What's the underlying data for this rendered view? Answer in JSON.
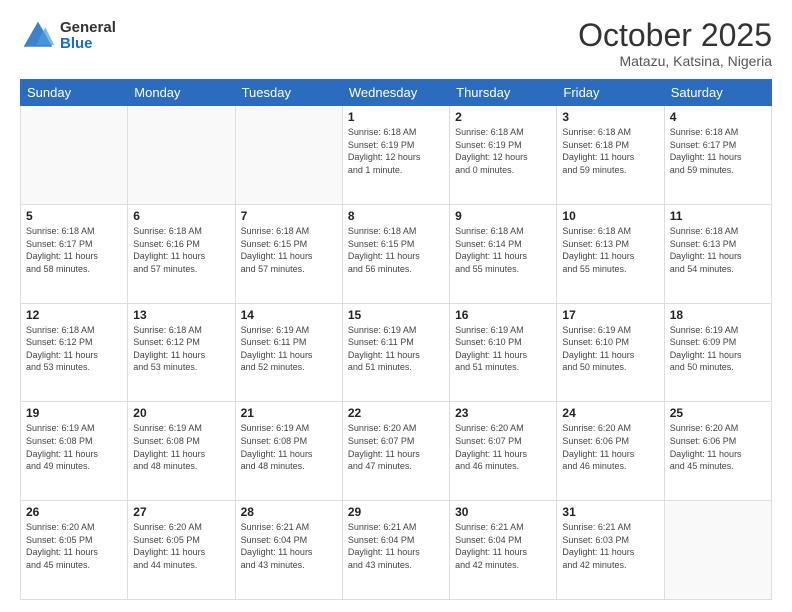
{
  "logo": {
    "general": "General",
    "blue": "Blue"
  },
  "header": {
    "month": "October 2025",
    "location": "Matazu, Katsina, Nigeria"
  },
  "weekdays": [
    "Sunday",
    "Monday",
    "Tuesday",
    "Wednesday",
    "Thursday",
    "Friday",
    "Saturday"
  ],
  "weeks": [
    [
      {
        "day": "",
        "info": ""
      },
      {
        "day": "",
        "info": ""
      },
      {
        "day": "",
        "info": ""
      },
      {
        "day": "1",
        "info": "Sunrise: 6:18 AM\nSunset: 6:19 PM\nDaylight: 12 hours\nand 1 minute."
      },
      {
        "day": "2",
        "info": "Sunrise: 6:18 AM\nSunset: 6:19 PM\nDaylight: 12 hours\nand 0 minutes."
      },
      {
        "day": "3",
        "info": "Sunrise: 6:18 AM\nSunset: 6:18 PM\nDaylight: 11 hours\nand 59 minutes."
      },
      {
        "day": "4",
        "info": "Sunrise: 6:18 AM\nSunset: 6:17 PM\nDaylight: 11 hours\nand 59 minutes."
      }
    ],
    [
      {
        "day": "5",
        "info": "Sunrise: 6:18 AM\nSunset: 6:17 PM\nDaylight: 11 hours\nand 58 minutes."
      },
      {
        "day": "6",
        "info": "Sunrise: 6:18 AM\nSunset: 6:16 PM\nDaylight: 11 hours\nand 57 minutes."
      },
      {
        "day": "7",
        "info": "Sunrise: 6:18 AM\nSunset: 6:15 PM\nDaylight: 11 hours\nand 57 minutes."
      },
      {
        "day": "8",
        "info": "Sunrise: 6:18 AM\nSunset: 6:15 PM\nDaylight: 11 hours\nand 56 minutes."
      },
      {
        "day": "9",
        "info": "Sunrise: 6:18 AM\nSunset: 6:14 PM\nDaylight: 11 hours\nand 55 minutes."
      },
      {
        "day": "10",
        "info": "Sunrise: 6:18 AM\nSunset: 6:13 PM\nDaylight: 11 hours\nand 55 minutes."
      },
      {
        "day": "11",
        "info": "Sunrise: 6:18 AM\nSunset: 6:13 PM\nDaylight: 11 hours\nand 54 minutes."
      }
    ],
    [
      {
        "day": "12",
        "info": "Sunrise: 6:18 AM\nSunset: 6:12 PM\nDaylight: 11 hours\nand 53 minutes."
      },
      {
        "day": "13",
        "info": "Sunrise: 6:18 AM\nSunset: 6:12 PM\nDaylight: 11 hours\nand 53 minutes."
      },
      {
        "day": "14",
        "info": "Sunrise: 6:19 AM\nSunset: 6:11 PM\nDaylight: 11 hours\nand 52 minutes."
      },
      {
        "day": "15",
        "info": "Sunrise: 6:19 AM\nSunset: 6:11 PM\nDaylight: 11 hours\nand 51 minutes."
      },
      {
        "day": "16",
        "info": "Sunrise: 6:19 AM\nSunset: 6:10 PM\nDaylight: 11 hours\nand 51 minutes."
      },
      {
        "day": "17",
        "info": "Sunrise: 6:19 AM\nSunset: 6:10 PM\nDaylight: 11 hours\nand 50 minutes."
      },
      {
        "day": "18",
        "info": "Sunrise: 6:19 AM\nSunset: 6:09 PM\nDaylight: 11 hours\nand 50 minutes."
      }
    ],
    [
      {
        "day": "19",
        "info": "Sunrise: 6:19 AM\nSunset: 6:08 PM\nDaylight: 11 hours\nand 49 minutes."
      },
      {
        "day": "20",
        "info": "Sunrise: 6:19 AM\nSunset: 6:08 PM\nDaylight: 11 hours\nand 48 minutes."
      },
      {
        "day": "21",
        "info": "Sunrise: 6:19 AM\nSunset: 6:08 PM\nDaylight: 11 hours\nand 48 minutes."
      },
      {
        "day": "22",
        "info": "Sunrise: 6:20 AM\nSunset: 6:07 PM\nDaylight: 11 hours\nand 47 minutes."
      },
      {
        "day": "23",
        "info": "Sunrise: 6:20 AM\nSunset: 6:07 PM\nDaylight: 11 hours\nand 46 minutes."
      },
      {
        "day": "24",
        "info": "Sunrise: 6:20 AM\nSunset: 6:06 PM\nDaylight: 11 hours\nand 46 minutes."
      },
      {
        "day": "25",
        "info": "Sunrise: 6:20 AM\nSunset: 6:06 PM\nDaylight: 11 hours\nand 45 minutes."
      }
    ],
    [
      {
        "day": "26",
        "info": "Sunrise: 6:20 AM\nSunset: 6:05 PM\nDaylight: 11 hours\nand 45 minutes."
      },
      {
        "day": "27",
        "info": "Sunrise: 6:20 AM\nSunset: 6:05 PM\nDaylight: 11 hours\nand 44 minutes."
      },
      {
        "day": "28",
        "info": "Sunrise: 6:21 AM\nSunset: 6:04 PM\nDaylight: 11 hours\nand 43 minutes."
      },
      {
        "day": "29",
        "info": "Sunrise: 6:21 AM\nSunset: 6:04 PM\nDaylight: 11 hours\nand 43 minutes."
      },
      {
        "day": "30",
        "info": "Sunrise: 6:21 AM\nSunset: 6:04 PM\nDaylight: 11 hours\nand 42 minutes."
      },
      {
        "day": "31",
        "info": "Sunrise: 6:21 AM\nSunset: 6:03 PM\nDaylight: 11 hours\nand 42 minutes."
      },
      {
        "day": "",
        "info": ""
      }
    ]
  ]
}
